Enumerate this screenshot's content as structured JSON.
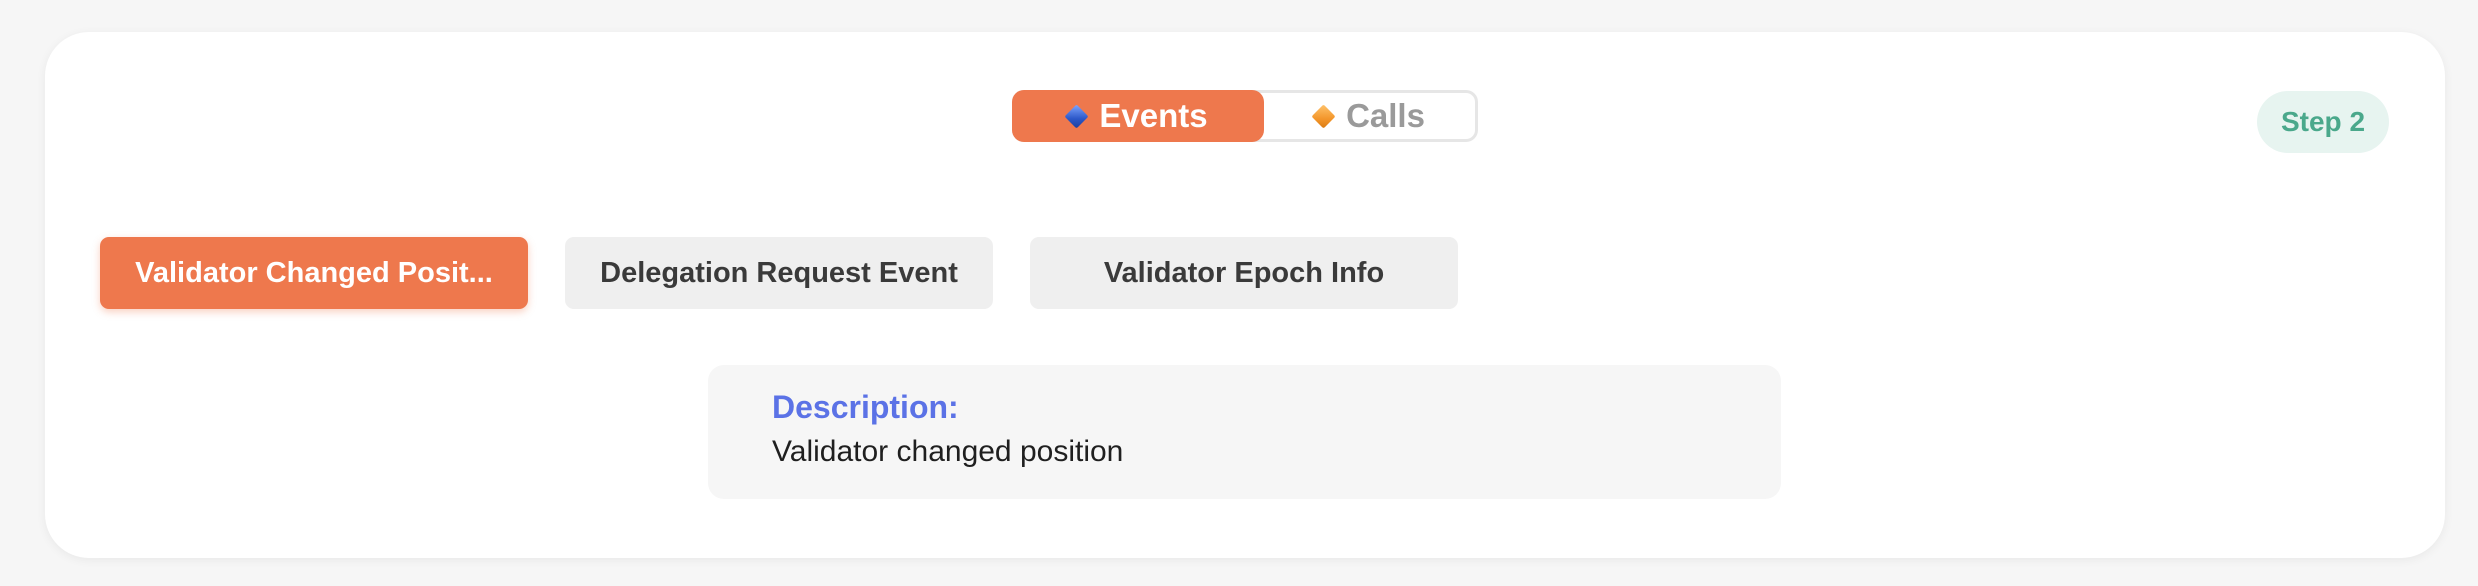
{
  "toggle": {
    "events_label": "Events",
    "calls_label": "Calls",
    "selected": "Events",
    "events_icon": "blue-diamond-icon",
    "calls_icon": "orange-diamond-icon"
  },
  "step": {
    "label": "Step 2"
  },
  "tabs": [
    {
      "label": "Validator Changed Posit...",
      "active": true
    },
    {
      "label": "Delegation Request Event",
      "active": false
    },
    {
      "label": "Validator Epoch Info",
      "active": false
    }
  ],
  "description": {
    "title": "Description:",
    "text": "Validator changed position"
  },
  "colors": {
    "accent": "#ee784d",
    "step_text": "#4aa88b",
    "step_bg": "#e7f4f0",
    "description_title": "#5b72e6"
  }
}
